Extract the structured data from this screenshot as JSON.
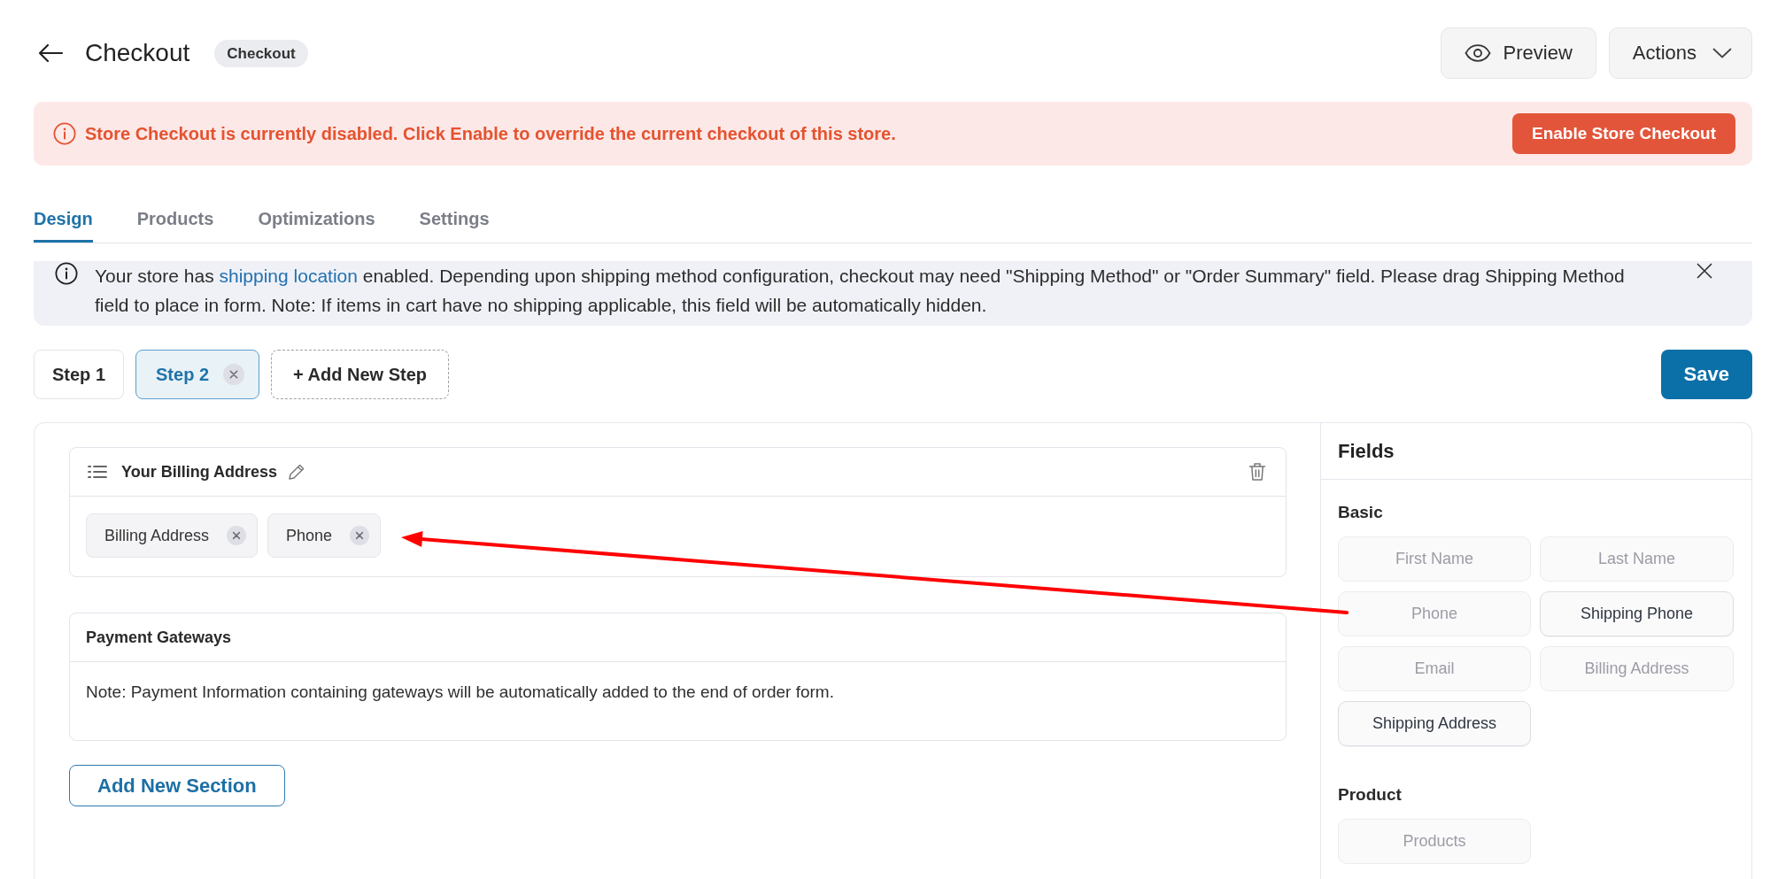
{
  "header": {
    "title": "Checkout",
    "badge": "Checkout",
    "actions": [
      {
        "kind": "preview",
        "label": "Preview"
      },
      {
        "kind": "menu",
        "label": "Actions"
      }
    ]
  },
  "alert": {
    "message": "Store Checkout is currently disabled. Click Enable to override the current checkout of this store.",
    "button": "Enable Store Checkout"
  },
  "tabs": [
    {
      "label": "Design",
      "selected": true
    },
    {
      "label": "Products",
      "selected": false
    },
    {
      "label": "Optimizations",
      "selected": false
    },
    {
      "label": "Settings",
      "selected": false
    }
  ],
  "notice": {
    "before": "Your store has ",
    "link": "shipping location",
    "after": " enabled. Depending upon shipping method configuration, checkout may need \"Shipping Method\" or \"Order Summary\" field. Please drag Shipping Method field to place in form. Note: If items in cart have no shipping applicable, this field will be automatically hidden."
  },
  "steps": [
    {
      "label": "Step 1",
      "selected": false,
      "removable": false
    },
    {
      "label": "Step 2",
      "selected": true,
      "removable": true
    }
  ],
  "add_step": "+ Add New Step",
  "save": "Save",
  "sections": [
    {
      "kind": "fields",
      "title": "Your Billing Address",
      "fields": [
        "Billing Address",
        "Phone"
      ]
    },
    {
      "kind": "note",
      "title": "Payment Gateways",
      "note": "Note: Payment Information containing gateways will be automatically added to the end of order form."
    }
  ],
  "add_section": "Add New Section",
  "fields_panel": {
    "title": "Fields",
    "groups": [
      {
        "title": "Basic",
        "items": [
          {
            "label": "First Name",
            "disabled": true
          },
          {
            "label": "Last Name",
            "disabled": true
          },
          {
            "label": "Phone",
            "disabled": true
          },
          {
            "label": "Shipping Phone",
            "disabled": false
          },
          {
            "label": "Email",
            "disabled": true
          },
          {
            "label": "Billing Address",
            "disabled": true
          },
          {
            "label": "Shipping Address",
            "disabled": false
          }
        ]
      },
      {
        "title": "Product",
        "items": [
          {
            "label": "Products",
            "disabled": true
          }
        ]
      }
    ]
  }
}
